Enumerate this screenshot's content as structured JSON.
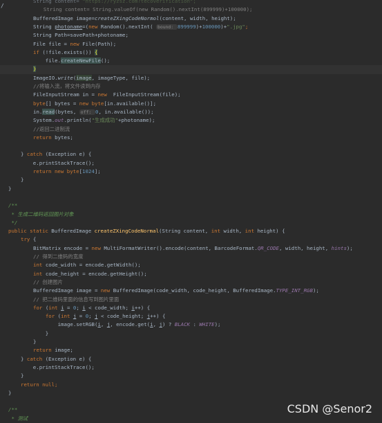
{
  "editor": {
    "watermark": "CSDN @Senor2",
    "gutter_marker": "/"
  },
  "lines": [
    {
      "i": 0,
      "segs": [
        [
          "String content= ",
          "t"
        ],
        [
          "\"https://ryzsz.com?tecoverification\";",
          "str"
        ]
      ],
      "faded": true
    },
    {
      "i": 1,
      "segs": [
        [
          "  String content= String.valueOf(new Random().nextInt(899999)+100000);",
          "com"
        ]
      ]
    },
    {
      "i": 2,
      "segs": [
        [
          "BufferedImage image=",
          "t"
        ],
        [
          "createZXingCodeNormol",
          "ital"
        ],
        [
          "(content, width, height);",
          "t"
        ]
      ]
    },
    {
      "i": 3,
      "segs": [
        [
          "String ",
          "t"
        ],
        [
          "photoname",
          "ul"
        ],
        [
          "=(",
          "t"
        ],
        [
          "new ",
          "kw"
        ],
        [
          "Random().nextInt( ",
          "t"
        ],
        [
          "bound: ",
          "hint"
        ],
        [
          "899999",
          "num"
        ],
        [
          ")+",
          "t"
        ],
        [
          "100000",
          "num"
        ],
        [
          ")+",
          "t"
        ],
        [
          "\".jpg\"",
          "str"
        ],
        [
          ";",
          "kw"
        ]
      ]
    },
    {
      "i": 4,
      "segs": [
        [
          "String Path=savePath+photoname;",
          "t"
        ]
      ]
    },
    {
      "i": 5,
      "segs": [
        [
          "File file = ",
          "t"
        ],
        [
          "new ",
          "kw"
        ],
        [
          "File(Path);",
          "t"
        ]
      ]
    },
    {
      "i": 6,
      "segs": [
        [
          "if ",
          "kw"
        ],
        [
          "(!file.exists()) ",
          "t"
        ],
        [
          "{",
          "brace"
        ]
      ]
    },
    {
      "i": 7,
      "segs": [
        [
          "    file.",
          "t"
        ],
        [
          "createNewFile",
          "hlw"
        ],
        [
          "();",
          "t"
        ]
      ]
    },
    {
      "i": 8,
      "segs": [
        [
          "}",
          "brace"
        ]
      ]
    },
    {
      "i": 9,
      "segs": [
        [
          "ImageIO.",
          "t"
        ],
        [
          "write",
          "ital"
        ],
        [
          "(",
          "t"
        ],
        [
          "image",
          "hl"
        ],
        [
          ", imageType, file);",
          "t"
        ]
      ]
    },
    {
      "i": 10,
      "segs": [
        [
          "//将输入流，将文件读到内存",
          "com"
        ]
      ]
    },
    {
      "i": 11,
      "segs": [
        [
          "FileInputStream in = ",
          "t"
        ],
        [
          "new  ",
          "kw"
        ],
        [
          "FileInputStream(file);",
          "t"
        ]
      ]
    },
    {
      "i": 12,
      "segs": [
        [
          "byte",
          "kw"
        ],
        [
          "[] bytes = ",
          "t"
        ],
        [
          "new ",
          "kw"
        ],
        [
          "byte",
          "kw"
        ],
        [
          "[in.available()];",
          "t"
        ]
      ]
    },
    {
      "i": 13,
      "segs": [
        [
          "in.",
          "t"
        ],
        [
          "read",
          "hlw"
        ],
        [
          "(bytes, ",
          "t"
        ],
        [
          "off: ",
          "hint"
        ],
        [
          "0",
          "num"
        ],
        [
          ", in.available());",
          "t"
        ]
      ]
    },
    {
      "i": 14,
      "segs": [
        [
          "System.",
          "t"
        ],
        [
          "out",
          "italicf"
        ],
        [
          ".println(",
          "t"
        ],
        [
          "\"生成成功\"",
          "str"
        ],
        [
          "+photoname);",
          "t"
        ]
      ]
    },
    {
      "i": 15,
      "segs": [
        [
          "//返回二进制流",
          "com"
        ]
      ]
    },
    {
      "i": 16,
      "segs": [
        [
          "return ",
          "kw"
        ],
        [
          "bytes;",
          "t"
        ]
      ]
    },
    {
      "i": 17,
      "segs": []
    },
    {
      "i": 18,
      "segs": [
        [
          "} ",
          "t"
        ],
        [
          "catch ",
          "kw"
        ],
        [
          "(Exception e) {",
          "t"
        ]
      ]
    },
    {
      "i": 19,
      "segs": [
        [
          "    e.printStackTrace();",
          "t"
        ]
      ]
    },
    {
      "i": 20,
      "segs": [
        [
          "    ",
          "t"
        ],
        [
          "return new ",
          "kw"
        ],
        [
          "byte",
          "kw"
        ],
        [
          "[",
          "t"
        ],
        [
          "1024",
          "num"
        ],
        [
          "];",
          "t"
        ]
      ]
    },
    {
      "i": 21,
      "segs": [
        [
          "}",
          "t"
        ]
      ]
    },
    {
      "i": 22,
      "segs": [
        [
          "}",
          "t"
        ]
      ]
    },
    {
      "i": 23,
      "segs": []
    },
    {
      "i": 24,
      "segs": [
        [
          "/**",
          "doc"
        ]
      ]
    },
    {
      "i": 25,
      "segs": [
        [
          " * 生成二维码返回图片对象",
          "doc"
        ]
      ]
    },
    {
      "i": 26,
      "segs": [
        [
          " */",
          "doc"
        ]
      ]
    },
    {
      "i": 27,
      "segs": [
        [
          "public static ",
          "kw"
        ],
        [
          "BufferedImage ",
          "t"
        ],
        [
          "createZXingCodeNormal",
          "meth"
        ],
        [
          "(String content, ",
          "t"
        ],
        [
          "int ",
          "kw"
        ],
        [
          "width, ",
          "t"
        ],
        [
          "int ",
          "kw"
        ],
        [
          "height) {",
          "t"
        ]
      ]
    },
    {
      "i": 28,
      "segs": [
        [
          "try ",
          "kw"
        ],
        [
          "{",
          "t"
        ]
      ]
    },
    {
      "i": 29,
      "segs": [
        [
          "BitMatrix encode = ",
          "t"
        ],
        [
          "new ",
          "kw"
        ],
        [
          "MultiFormatWriter().encode(content, BarcodeFormat.",
          "t"
        ],
        [
          "QR_CODE",
          "italicf"
        ],
        [
          ", width, height, ",
          "t"
        ],
        [
          "hints",
          "italicf"
        ],
        [
          ");",
          "t"
        ]
      ]
    },
    {
      "i": 30,
      "segs": [
        [
          "// 得到二维码的宽度",
          "com"
        ]
      ]
    },
    {
      "i": 31,
      "segs": [
        [
          "int ",
          "kw"
        ],
        [
          "code_width = encode.getWidth();",
          "t"
        ]
      ]
    },
    {
      "i": 32,
      "segs": [
        [
          "int ",
          "kw"
        ],
        [
          "code_height = encode.getHeight();",
          "t"
        ]
      ]
    },
    {
      "i": 33,
      "segs": [
        [
          "// 创建图片",
          "com"
        ]
      ]
    },
    {
      "i": 34,
      "segs": [
        [
          "BufferedImage image = ",
          "t"
        ],
        [
          "new ",
          "kw"
        ],
        [
          "BufferedImage(code_width, code_height, BufferedImage.",
          "t"
        ],
        [
          "TYPE_INT_RGB",
          "italicf"
        ],
        [
          ");",
          "t"
        ]
      ]
    },
    {
      "i": 35,
      "segs": [
        [
          "// 把二维码里面的信息写到图片里面",
          "com"
        ]
      ]
    },
    {
      "i": 36,
      "segs": [
        [
          "for ",
          "kw"
        ],
        [
          "(",
          "t"
        ],
        [
          "int ",
          "kw"
        ],
        [
          "i",
          "ul"
        ],
        [
          " = ",
          "t"
        ],
        [
          "0",
          "num"
        ],
        [
          "; ",
          "t"
        ],
        [
          "i",
          "ul"
        ],
        [
          " < code_width; ",
          "t"
        ],
        [
          "i",
          "ul"
        ],
        [
          "++) {",
          "t"
        ]
      ]
    },
    {
      "i": 37,
      "segs": [
        [
          "    ",
          "t"
        ],
        [
          "for ",
          "kw"
        ],
        [
          "(",
          "t"
        ],
        [
          "int ",
          "kw"
        ],
        [
          "j",
          "ul"
        ],
        [
          " = ",
          "t"
        ],
        [
          "0",
          "num"
        ],
        [
          "; ",
          "t"
        ],
        [
          "j",
          "ul"
        ],
        [
          " < code_height; ",
          "t"
        ],
        [
          "j",
          "ul"
        ],
        [
          "++) {",
          "t"
        ]
      ]
    },
    {
      "i": 38,
      "segs": [
        [
          "        image.setRGB(",
          "t"
        ],
        [
          "i",
          "ul"
        ],
        [
          ", ",
          "t"
        ],
        [
          "j",
          "ul"
        ],
        [
          ", encode.get(",
          "t"
        ],
        [
          "i",
          "ul"
        ],
        [
          ", ",
          "t"
        ],
        [
          "j",
          "ul"
        ],
        [
          ") ? ",
          "t"
        ],
        [
          "BLACK",
          "italicf"
        ],
        [
          " : ",
          "t"
        ],
        [
          "WHITE",
          "italicf"
        ],
        [
          ");",
          "t"
        ]
      ]
    },
    {
      "i": 39,
      "segs": [
        [
          "    }",
          "t"
        ]
      ]
    },
    {
      "i": 40,
      "segs": [
        [
          "}",
          "t"
        ]
      ]
    },
    {
      "i": 41,
      "segs": [
        [
          "return ",
          "kw"
        ],
        [
          "image;",
          "t"
        ]
      ]
    },
    {
      "i": 42,
      "segs": [
        [
          "} ",
          "t"
        ],
        [
          "catch ",
          "kw"
        ],
        [
          "(Exception e) {",
          "t"
        ]
      ]
    },
    {
      "i": 43,
      "segs": [
        [
          "    e.printStackTrace();",
          "t"
        ]
      ]
    },
    {
      "i": 44,
      "segs": [
        [
          "}",
          "t"
        ]
      ]
    },
    {
      "i": 45,
      "segs": [
        [
          "return null",
          "kw"
        ],
        [
          ";",
          "kw"
        ]
      ]
    },
    {
      "i": 46,
      "segs": [
        [
          "}",
          "t"
        ]
      ]
    },
    {
      "i": 47,
      "segs": []
    },
    {
      "i": 48,
      "segs": [
        [
          "/**",
          "doc"
        ]
      ]
    },
    {
      "i": 49,
      "segs": [
        [
          " * 测试",
          "doc"
        ]
      ]
    }
  ]
}
